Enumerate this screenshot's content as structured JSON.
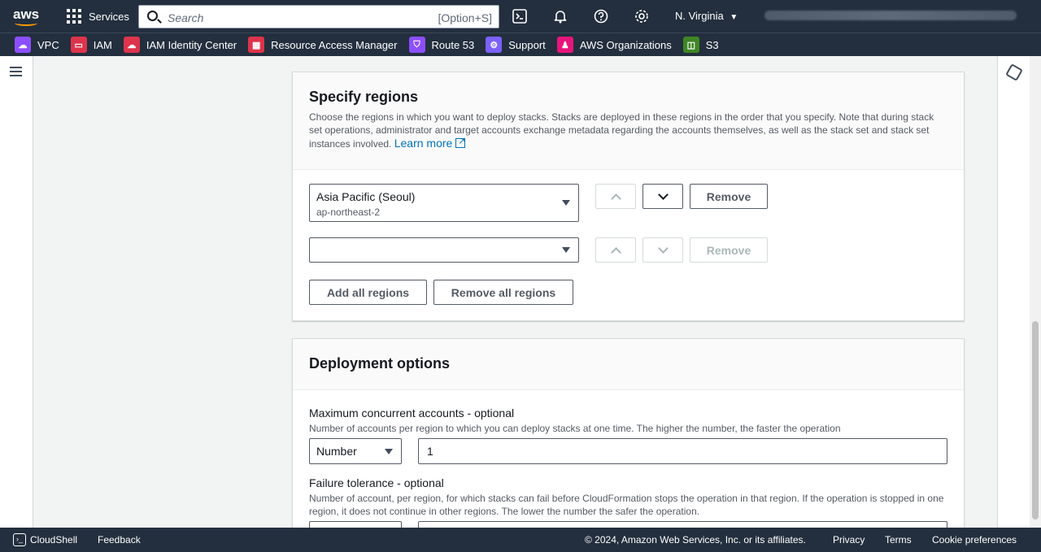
{
  "topnav": {
    "logo": "aws",
    "services_label": "Services",
    "search_placeholder": "Search",
    "search_shortcut": "[Option+S]",
    "region": "N. Virginia"
  },
  "favorites": [
    {
      "label": "VPC",
      "color": "#8c4fff",
      "icon": "vpc-icon"
    },
    {
      "label": "IAM",
      "color": "#dd344c",
      "icon": "iam-icon"
    },
    {
      "label": "IAM Identity Center",
      "color": "#dd344c",
      "icon": "identity-center-icon"
    },
    {
      "label": "Resource Access Manager",
      "color": "#dd344c",
      "icon": "ram-icon"
    },
    {
      "label": "Route 53",
      "color": "#8c4fff",
      "icon": "route53-icon"
    },
    {
      "label": "Support",
      "color": "#7b61ff",
      "icon": "support-icon"
    },
    {
      "label": "AWS Organizations",
      "color": "#e7157b",
      "icon": "organizations-icon"
    },
    {
      "label": "S3",
      "color": "#3f8624",
      "icon": "s3-icon"
    }
  ],
  "regions_panel": {
    "title": "Specify regions",
    "description": "Choose the regions in which you want to deploy stacks. Stacks are deployed in these regions in the order that you specify. Note that during stack set operations, administrator and target accounts exchange metadata regarding the accounts themselves, as well as the stack set and stack set instances involved.",
    "learn_more": "Learn more",
    "rows": [
      {
        "region_name": "Asia Pacific (Seoul)",
        "region_code": "ap-northeast-2",
        "remove_label": "Remove"
      },
      {
        "region_name": "",
        "region_code": "",
        "remove_label": "Remove"
      }
    ],
    "add_all_label": "Add all regions",
    "remove_all_label": "Remove all regions"
  },
  "deployment_panel": {
    "title": "Deployment options",
    "max_concurrent": {
      "label": "Maximum concurrent accounts - optional",
      "description": "Number of accounts per region to which you can deploy stacks at one time. The higher the number, the faster the operation",
      "type_value": "Number",
      "value": "1"
    },
    "failure_tolerance": {
      "label": "Failure tolerance - optional",
      "description": "Number of account, per region, for which stacks can fail before CloudFormation stops the operation in that region. If the operation is stopped in one region, it does not continue in other regions. The lower the number the safer the operation."
    }
  },
  "footer": {
    "cloudshell": "CloudShell",
    "feedback": "Feedback",
    "copyright": "© 2024, Amazon Web Services, Inc. or its affiliates.",
    "privacy": "Privacy",
    "terms": "Terms",
    "cookies": "Cookie preferences"
  }
}
